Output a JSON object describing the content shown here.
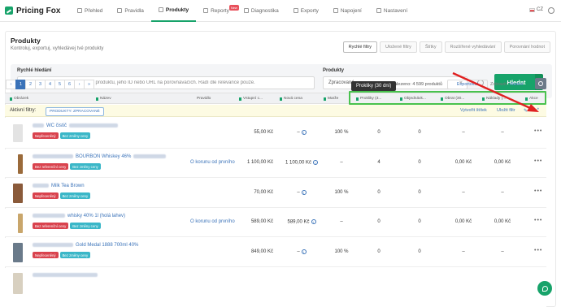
{
  "app": {
    "logo_text": "Pricing Fox",
    "brand_color": "#17a36a"
  },
  "nav": {
    "items": [
      {
        "label": "Přehled"
      },
      {
        "label": "Pravidla"
      },
      {
        "label": "Produkty"
      },
      {
        "label": "Reporty",
        "badge": "New"
      },
      {
        "label": "Diagnostika"
      },
      {
        "label": "Exporty"
      },
      {
        "label": "Napojení"
      },
      {
        "label": "Nastavení"
      }
    ],
    "active": "Produkty",
    "language": "CZ"
  },
  "page": {
    "title": "Produkty",
    "subtitle": "Kontroluj, exportuj, vyhledávej tvé produkty",
    "tabs": [
      "Rychlé filtry",
      "Uložené filtry",
      "Štítky",
      "Rozšířené vyhledávání",
      "Porovnání hodnot"
    ],
    "active_tab": "Rychlé filtry"
  },
  "search": {
    "quick_label": "Rychlé hledání",
    "quick_placeholder": "Vyhledává fulltextově v názvu produktu, jeho ID nebo URL na porovnávačích. Řadí dle relevance pouze.",
    "products_label": "Produkty",
    "products_value": "Zpracované",
    "clear": "×",
    "search_button": "Hledat",
    "caret": "▾"
  },
  "pager": {
    "prev": "‹",
    "pages": [
      "1",
      "2",
      "3",
      "4",
      "5",
      "6"
    ],
    "active_page": "1",
    "next": "›",
    "last": "»",
    "found_text": "alezeno: 4 599 produktů",
    "tooltip": "Prokliky (30 dní)",
    "export_label": "Exportovat",
    "view_label": "Zobrazit:",
    "view_value": "Vlastní"
  },
  "columns": [
    "Obrázek",
    "Název",
    "Pravidlo",
    "Vstupní c...",
    "Nová cena",
    "Marže",
    "Prokliky (3...",
    "Objednávk...",
    "Obrat (30...",
    "Náklady (...",
    "Akce"
  ],
  "filters": {
    "label": "Aktivní filtry:",
    "chip": "PRODUKTY: ZPRACOVANÉ",
    "create_label": "Vytvořit štítek",
    "save_label": "Uložit filtr"
  },
  "rows": [
    {
      "name": "WC čistič",
      "tags": [
        "Nepřeceněný",
        "Bez změny ceny"
      ],
      "rule": "",
      "input_price": "55,00 Kč",
      "new_price": "–",
      "margin": "100 %",
      "clicks": "0",
      "orders": "0",
      "revenue": "–",
      "costs": "–"
    },
    {
      "name": "BOURBON Whiskey 46%",
      "tags": [
        "Bez referenční ceny",
        "Bez změny ceny"
      ],
      "rule": "O korunu od prvního",
      "input_price": "1 100,00 Kč",
      "new_price": "1 100,00 Kč",
      "margin": "–",
      "clicks": "4",
      "orders": "0",
      "revenue": "0,00 Kč",
      "costs": "0,00 Kč"
    },
    {
      "name": "Milk Tea Brown",
      "tags": [
        "Nepřeceněný",
        "Bez změny ceny"
      ],
      "rule": "",
      "input_price": "70,00 Kč",
      "new_price": "–",
      "margin": "100 %",
      "clicks": "0",
      "orders": "0",
      "revenue": "–",
      "costs": "–"
    },
    {
      "name": "whisky 40% 1l (holá lahev)",
      "tags": [
        "Bez referenční ceny",
        "Bez změny ceny"
      ],
      "rule": "O korunu od prvního",
      "input_price": "589,00 Kč",
      "new_price": "589,00 Kč",
      "margin": "–",
      "clicks": "0",
      "orders": "0",
      "revenue": "0,00 Kč",
      "costs": "0,00 Kč"
    },
    {
      "name": "Gold Medal 1888 700ml 40%",
      "tags": [
        "Nepřeceněný",
        "Bez změny ceny"
      ],
      "rule": "",
      "input_price": "849,00 Kč",
      "new_price": "–",
      "margin": "100 %",
      "clicks": "0",
      "orders": "0",
      "revenue": "–",
      "costs": "–"
    }
  ],
  "colors": {
    "link": "#3b73b9",
    "tag_red": "#d9434e",
    "tag_teal": "#3bb7c8",
    "highlight_green": "#49c24e",
    "arrow_red": "#e02020"
  }
}
